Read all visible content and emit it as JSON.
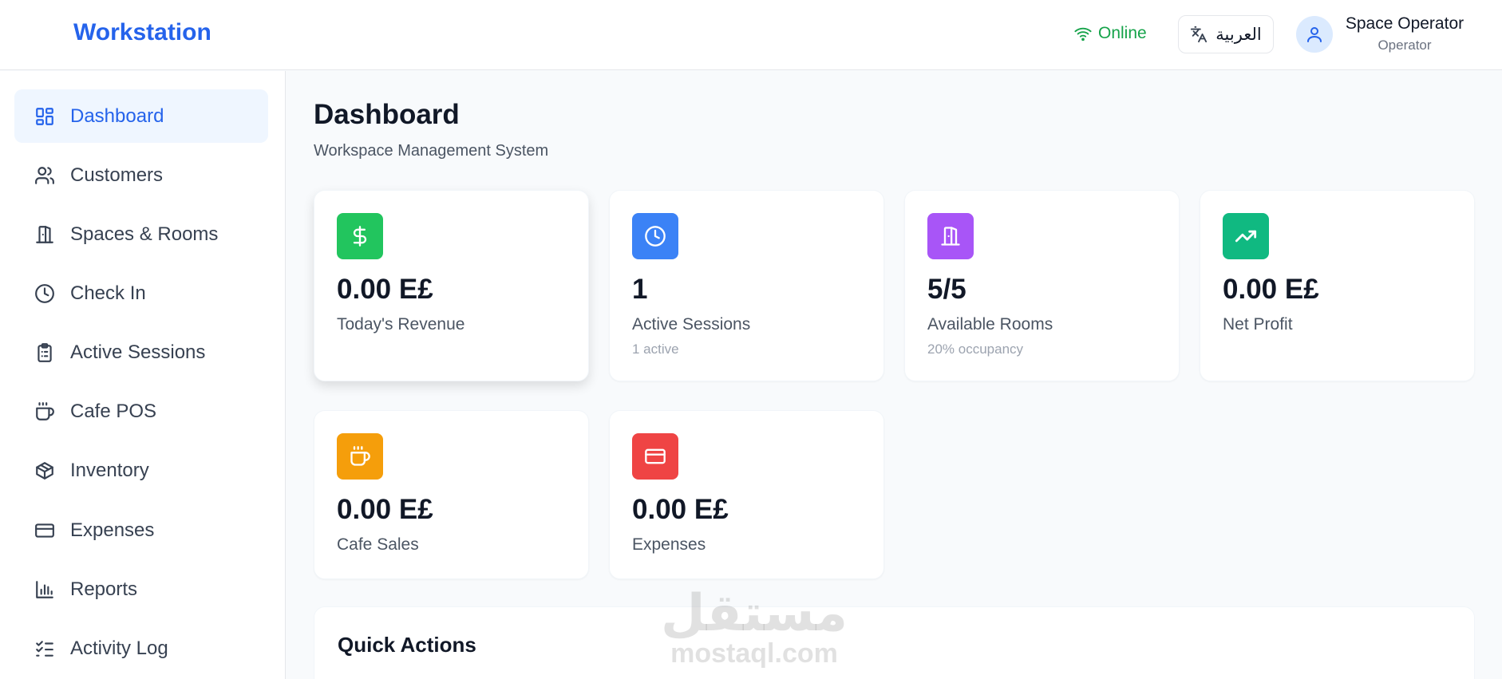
{
  "header": {
    "brand": "Workstation",
    "status": "Online",
    "language_button": "العربية",
    "user_name": "Space Operator",
    "user_role": "Operator"
  },
  "sidebar": {
    "items": [
      {
        "label": "Dashboard",
        "icon": "layout-dashboard-icon",
        "active": true
      },
      {
        "label": "Customers",
        "icon": "users-icon"
      },
      {
        "label": "Spaces & Rooms",
        "icon": "door-icon"
      },
      {
        "label": "Check In",
        "icon": "clock-icon"
      },
      {
        "label": "Active Sessions",
        "icon": "clipboard-list-icon"
      },
      {
        "label": "Cafe POS",
        "icon": "coffee-icon"
      },
      {
        "label": "Inventory",
        "icon": "package-icon"
      },
      {
        "label": "Expenses",
        "icon": "credit-card-icon"
      },
      {
        "label": "Reports",
        "icon": "bar-chart-icon"
      },
      {
        "label": "Activity Log",
        "icon": "list-checks-icon"
      }
    ]
  },
  "main": {
    "title": "Dashboard",
    "subtitle": "Workspace Management System",
    "stats": [
      {
        "value": "0.00 E£",
        "label": "Today's Revenue",
        "icon": "dollar-icon",
        "color": "#22c55e"
      },
      {
        "value": "1",
        "label": "Active Sessions",
        "note": "1 active",
        "icon": "clock-icon",
        "color": "#3b82f6"
      },
      {
        "value": "5/5",
        "label": "Available Rooms",
        "note": "20% occupancy",
        "icon": "door-icon",
        "color": "#a855f7"
      },
      {
        "value": "0.00 E£",
        "label": "Net Profit",
        "icon": "trending-up-icon",
        "color": "#10b981"
      },
      {
        "value": "0.00 E£",
        "label": "Cafe Sales",
        "icon": "coffee-icon",
        "color": "#f59e0b"
      },
      {
        "value": "0.00 E£",
        "label": "Expenses",
        "icon": "credit-card-icon",
        "color": "#ef4444"
      }
    ],
    "quick_actions_title": "Quick Actions"
  },
  "watermark": {
    "arabic": "مستقل",
    "latin": "mostaql.com"
  },
  "colors": {
    "accent": "#2563eb",
    "online": "#16a34a",
    "active_nav_bg": "#eff6ff"
  }
}
